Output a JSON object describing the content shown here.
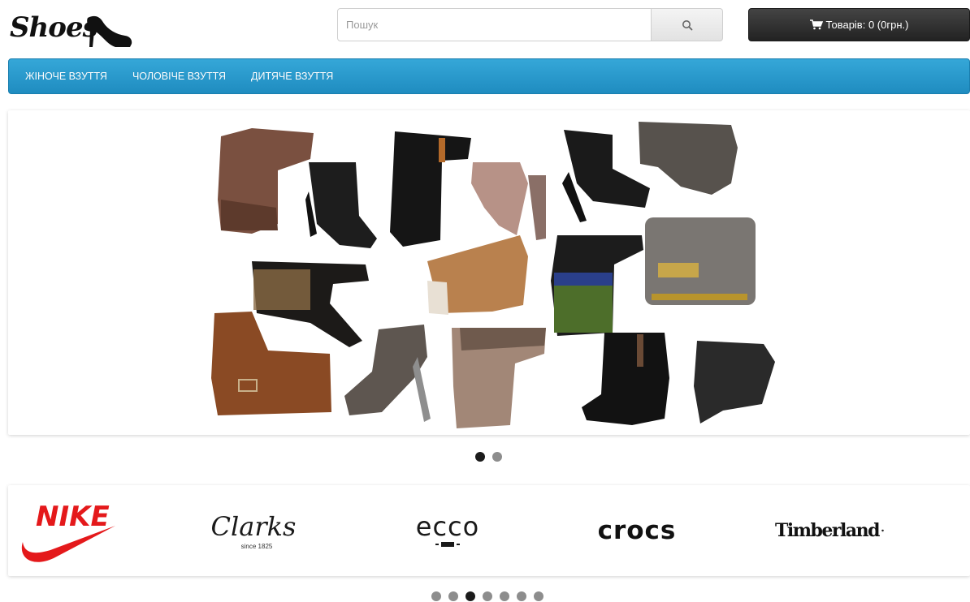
{
  "header": {
    "logo_text": "Shoes",
    "search": {
      "placeholder": "Пошук",
      "value": ""
    },
    "cart": {
      "label": "Товарів: 0 (0грн.)"
    }
  },
  "nav": {
    "items": [
      {
        "label": "Жіноче взуття"
      },
      {
        "label": "Чоловіче взуття"
      },
      {
        "label": "Дитяче взуття"
      }
    ]
  },
  "slider": {
    "slide_count": 2,
    "active_index": 0
  },
  "brands": {
    "items": [
      {
        "name": "NIKE"
      },
      {
        "name": "Clarks",
        "tagline": "since 1825"
      },
      {
        "name": "ecco"
      },
      {
        "name": "crocs"
      },
      {
        "name": "Timberland"
      }
    ],
    "page_count": 7,
    "active_index": 2
  },
  "colors": {
    "nav_bg": "#2a9ccf",
    "cart_bg": "#2b2b2b",
    "nike_red": "#e4191b"
  }
}
